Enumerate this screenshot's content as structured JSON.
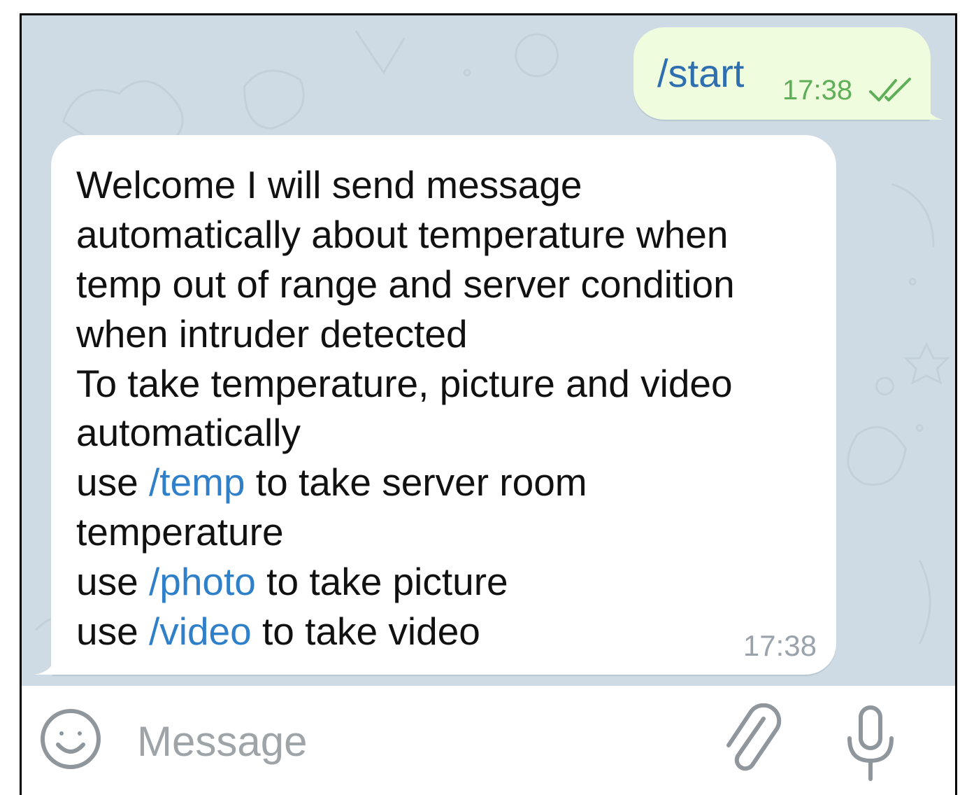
{
  "outgoing": {
    "text": "/start",
    "time": "17:38",
    "status_icon": "double-check-icon"
  },
  "incoming": {
    "lines": [
      [
        {
          "t": "Welcome I will send message",
          "cmd": false
        }
      ],
      [
        {
          "t": "automatically about temperature when",
          "cmd": false
        }
      ],
      [
        {
          "t": "temp out of range and server condition",
          "cmd": false
        }
      ],
      [
        {
          "t": "when intruder detected",
          "cmd": false
        }
      ],
      [
        {
          "t": "To take temperature,  picture and  video",
          "cmd": false
        }
      ],
      [
        {
          "t": "automatically",
          "cmd": false
        }
      ],
      [
        {
          "t": "use ",
          "cmd": false
        },
        {
          "t": "/temp",
          "cmd": true
        },
        {
          "t": " to take server room",
          "cmd": false
        }
      ],
      [
        {
          "t": "temperature",
          "cmd": false
        }
      ],
      [
        {
          "t": "use ",
          "cmd": false
        },
        {
          "t": "/photo",
          "cmd": true
        },
        {
          "t": " to take picture",
          "cmd": false
        }
      ],
      [
        {
          "t": "use ",
          "cmd": false
        },
        {
          "t": "/video",
          "cmd": true
        },
        {
          "t": " to take video",
          "cmd": false
        }
      ]
    ],
    "time": "17:38"
  },
  "input": {
    "placeholder": "Message",
    "left_icon": "emoji-icon",
    "right_icons": [
      "attach-icon",
      "mic-icon"
    ]
  },
  "colors": {
    "chat_background": "#cfdbe4",
    "outgoing_bubble": "#effdde",
    "incoming_bubble": "#ffffff",
    "command_link": "#2f80c9",
    "outgoing_time": "#5fae58",
    "incoming_time": "#9aa3ab",
    "placeholder": "#9fa4a8"
  }
}
